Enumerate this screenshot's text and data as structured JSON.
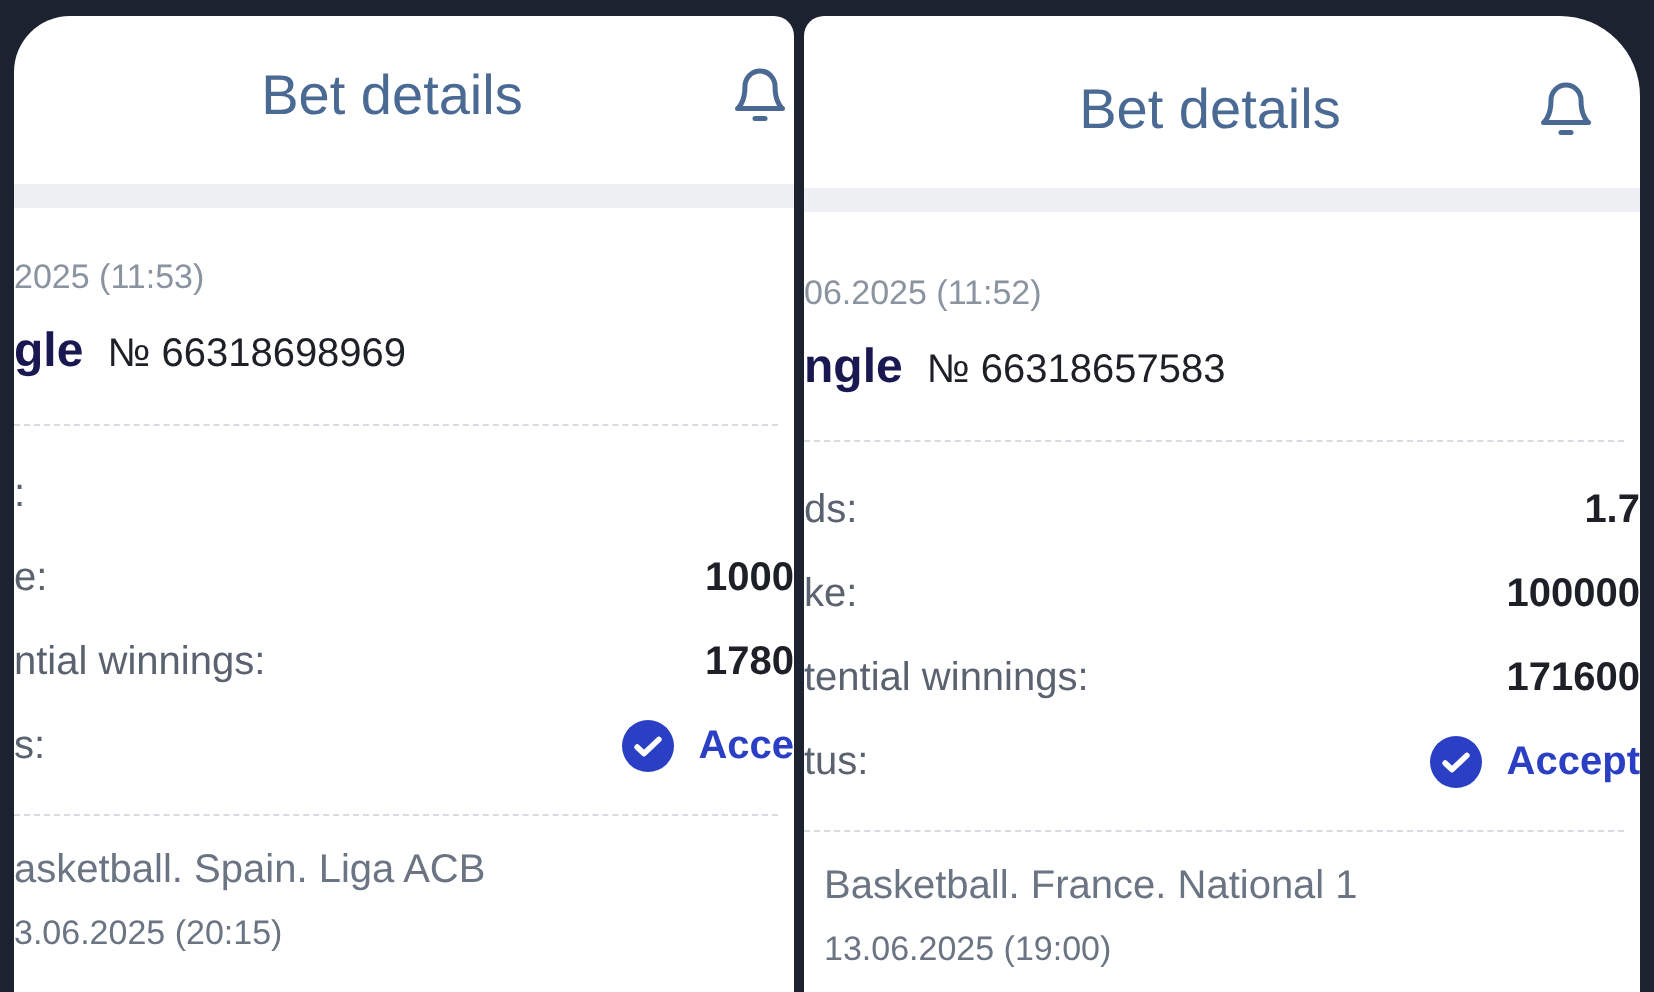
{
  "panels": [
    {
      "title": "Bet details",
      "date": "2025 (11:53)",
      "bet_type": "gle",
      "bet_number": "№ 66318698969",
      "rows": [
        {
          "kind": "plain",
          "label": ":"
        },
        {
          "kind": "plain",
          "label": "e:",
          "value": "1000"
        },
        {
          "kind": "plain",
          "label": "ntial winnings:",
          "value": "1780"
        },
        {
          "kind": "status",
          "label": "s:",
          "value": "Acce"
        }
      ],
      "event": {
        "league": "asketball. Spain. Liga ACB",
        "date": "3.06.2025 (20:15)"
      }
    },
    {
      "title": "Bet details",
      "date": "06.2025 (11:52)",
      "bet_type": "ngle",
      "bet_number": "№ 66318657583",
      "rows": [
        {
          "kind": "plain",
          "label": "ds:",
          "value": "1.7"
        },
        {
          "kind": "plain",
          "label": "ke:",
          "value": "100000"
        },
        {
          "kind": "plain",
          "label": "tential winnings:",
          "value": "171600"
        },
        {
          "kind": "status",
          "label": "tus:",
          "value": "Accept"
        }
      ],
      "event": {
        "league": "Basketball. France. National 1",
        "date": "13.06.2025 (19:00)"
      }
    }
  ]
}
